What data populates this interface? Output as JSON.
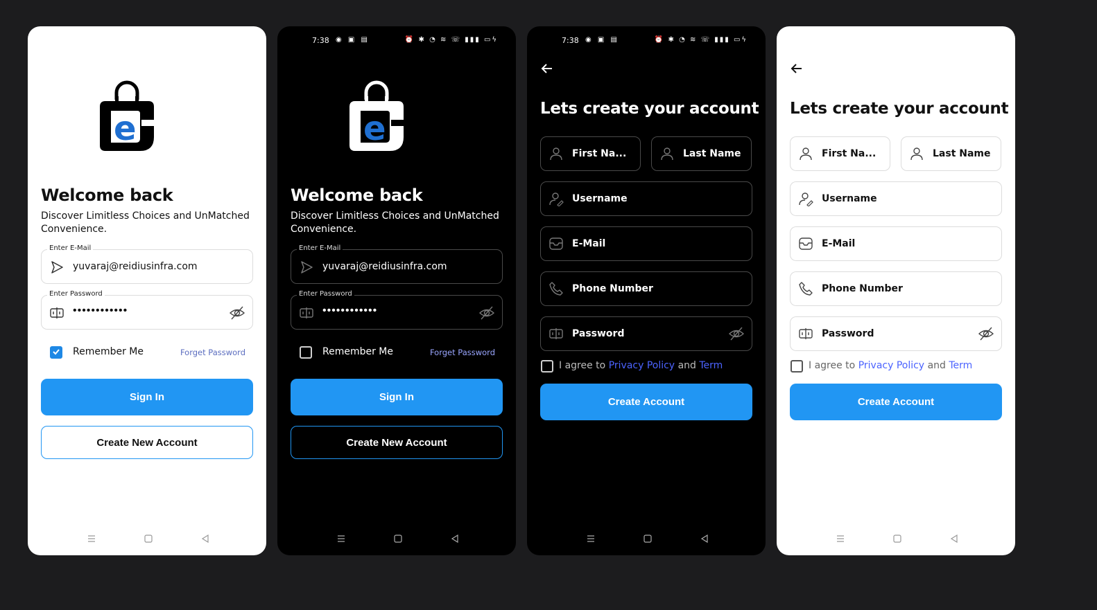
{
  "status_bar": {
    "time": "7:38"
  },
  "signin": {
    "title": "Welcome back",
    "subtitle": "Discover Limitless Choices and UnMatched Convenience.",
    "email_label": "Enter E-Mail",
    "email_value": "yuvaraj@reidiusinfra.com",
    "password_label": "Enter Password",
    "password_value": "••••••••••••",
    "remember_label": "Remember Me",
    "forget_label": "Forget Password",
    "signin_label": "Sign In",
    "create_new_label": "Create New Account"
  },
  "signup": {
    "title": "Lets create your account",
    "first_name": "First Na...",
    "last_name": "Last Name",
    "username": "Username",
    "email": "E-Mail",
    "phone": "Phone Number",
    "password": "Password",
    "agree_prefix": "I agree to",
    "privacy": "Privacy Policy",
    "and": "and",
    "term": "Term",
    "create_label": "Create Account"
  },
  "colors": {
    "accent": "#2196f3",
    "link": "#4b63ff",
    "light_bg": "#ffffff",
    "dark_bg": "#000000",
    "page_bg": "#1c1c1e"
  },
  "icons": [
    "send-icon",
    "key-icon",
    "eye-off-icon",
    "user-icon",
    "user-edit-icon",
    "mail-icon",
    "phone-icon",
    "back-arrow-icon",
    "menu-icon",
    "home-icon",
    "nav-back-icon",
    "bag-logo-icon",
    "check-icon"
  ]
}
